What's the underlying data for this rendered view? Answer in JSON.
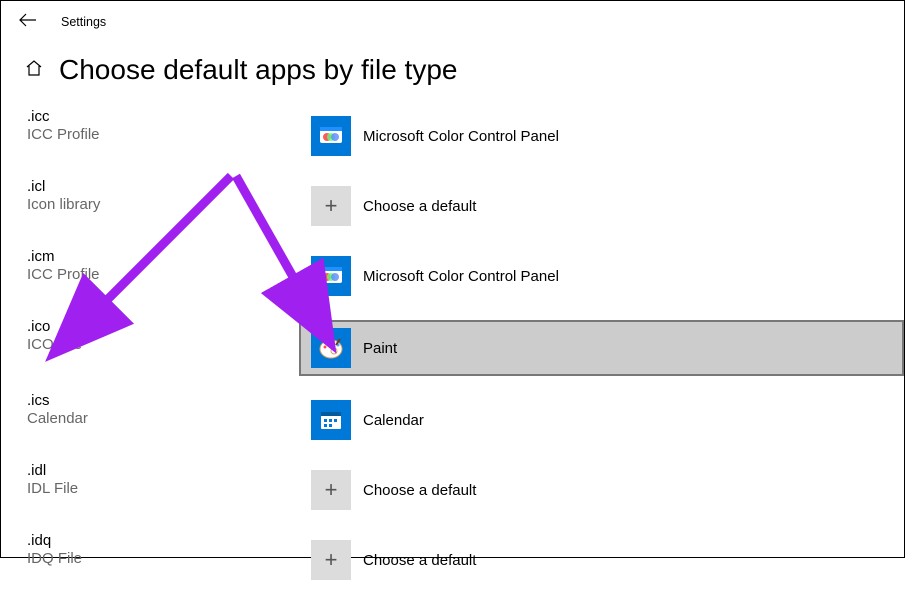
{
  "header": {
    "title": "Settings"
  },
  "page": {
    "title": "Choose default apps by file type"
  },
  "rows": [
    {
      "ext": ".icc",
      "desc": "ICC Profile",
      "app": "Microsoft Color Control Panel",
      "icon": "mccp"
    },
    {
      "ext": ".icl",
      "desc": "Icon library",
      "app": "Choose a default",
      "icon": "plus"
    },
    {
      "ext": ".icm",
      "desc": "ICC Profile",
      "app": "Microsoft Color Control Panel",
      "icon": "mccp"
    },
    {
      "ext": ".ico",
      "desc": "ICO File",
      "app": "Paint",
      "icon": "paint",
      "hover": true
    },
    {
      "ext": ".ics",
      "desc": "Calendar",
      "app": "Calendar",
      "icon": "calendar"
    },
    {
      "ext": ".idl",
      "desc": "IDL File",
      "app": "Choose a default",
      "icon": "plus"
    },
    {
      "ext": ".idq",
      "desc": "IDQ File",
      "app": "Choose a default",
      "icon": "plus"
    }
  ]
}
